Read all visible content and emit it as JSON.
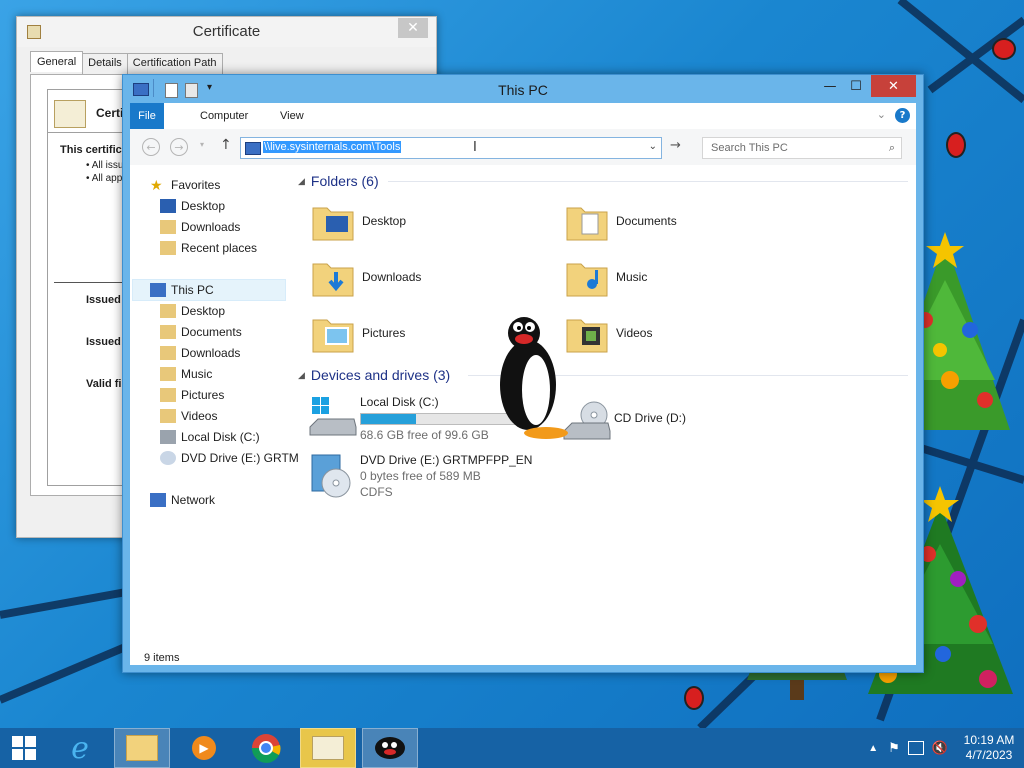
{
  "desktop": {
    "accent": "#1e8fd6"
  },
  "certificate": {
    "title": "Certificate",
    "tabs": [
      "General",
      "Details",
      "Certification Path"
    ],
    "info_heading_partial": "Certi",
    "purpose_partial": "This certific",
    "bullets": [
      "• All issu",
      "• All app"
    ],
    "issued_to_partial": "Issued",
    "issued_by_partial": "Issued",
    "valid_partial": "Valid fi"
  },
  "explorer": {
    "title": "This PC",
    "ribbon_tabs": {
      "file": "File",
      "computer": "Computer",
      "view": "View"
    },
    "address": "\\\\live.sysinternals.com\\Tools",
    "search_placeholder": "Search This PC",
    "nav": {
      "favorites": "Favorites",
      "fav_items": [
        "Desktop",
        "Downloads",
        "Recent places"
      ],
      "this_pc": "This PC",
      "pc_items": [
        "Desktop",
        "Documents",
        "Downloads",
        "Music",
        "Pictures",
        "Videos",
        "Local Disk (C:)",
        "DVD Drive (E:) GRTM"
      ],
      "network": "Network"
    },
    "folders_header": "Folders (6)",
    "folders": [
      "Desktop",
      "Documents",
      "Downloads",
      "Music",
      "Pictures",
      "Videos"
    ],
    "devices_header": "Devices and drives (3)",
    "drives": {
      "c": {
        "name": "Local Disk (C:)",
        "free": "68.6 GB free of 99.6 GB",
        "used_fraction": 0.31
      },
      "d": {
        "name": "CD Drive (D:)"
      },
      "e": {
        "name": "DVD Drive (E:) GRTMPFPP_EN",
        "free": "0 bytes free of 589 MB",
        "fs": "CDFS"
      }
    },
    "status": "9 items"
  },
  "taskbar": {
    "time": "10:19 AM",
    "date": "4/7/2023"
  }
}
